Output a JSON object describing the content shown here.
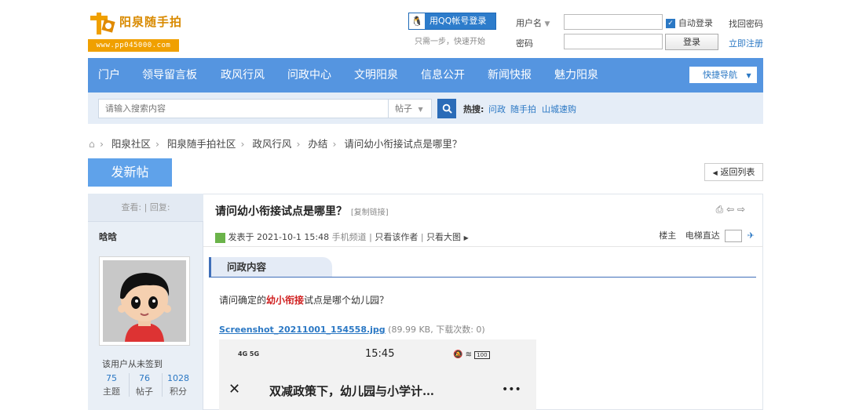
{
  "brand": {
    "name": "阳泉随手拍",
    "url": "www.pp045000.com",
    "accent": "#f0a000"
  },
  "login": {
    "qq_button": "用QQ帐号登录",
    "qq_hint": "只需一步，快速开始",
    "username_label": "用户名",
    "password_label": "密码",
    "username_value": "",
    "password_value": "",
    "auto_login": "自动登录",
    "auto_login_checked": true,
    "forgot": "找回密码",
    "login_button": "登录",
    "register": "立即注册"
  },
  "nav": {
    "items": [
      "门户",
      "领导留言板",
      "政风行风",
      "问政中心",
      "文明阳泉",
      "信息公开",
      "新闻快报",
      "魅力阳泉"
    ],
    "quick_nav": "快捷导航"
  },
  "search": {
    "placeholder": "请输入搜索内容",
    "type": "帖子",
    "hot_label": "热搜:",
    "hot_links": [
      "问政",
      "随手拍",
      "山城速购"
    ]
  },
  "breadcrumb": [
    "阳泉社区",
    "阳泉随手拍社区",
    "政风行风",
    "办结",
    "请问幼小衔接试点是哪里？"
  ],
  "actions": {
    "new_post": "发新帖",
    "back": "返回列表"
  },
  "sidebar": {
    "views_replies": "查看: | 回复:",
    "username": "晗晗",
    "sign_status": "该用户从未签到",
    "stats": [
      {
        "value": "75",
        "label": "主题"
      },
      {
        "value": "76",
        "label": "帖子"
      },
      {
        "value": "1028",
        "label": "积分"
      }
    ]
  },
  "post": {
    "title": "请问幼小衔接试点是哪里？",
    "copy_link": "[复制链接]",
    "posted": "发表于 2021-10-1 15:48",
    "via": "手机频道",
    "only_author": "只看该作者",
    "big_image": "只看大图",
    "floor_label": "楼主",
    "elevator": "电梯直达",
    "section": "问政内容",
    "text_before": "请问确定的",
    "text_highlight": "幼小衔接",
    "text_after": "试点是哪个幼儿园？",
    "attachment_name": "Screenshot_20211001_154558.jpg",
    "attachment_info": "(89.99 KB, 下载次数: 0)",
    "screenshot": {
      "status_left": "4G 5G",
      "time": "15:45",
      "battery": "100",
      "title": "双减政策下，幼儿园与小学计…",
      "more": "•••"
    }
  }
}
